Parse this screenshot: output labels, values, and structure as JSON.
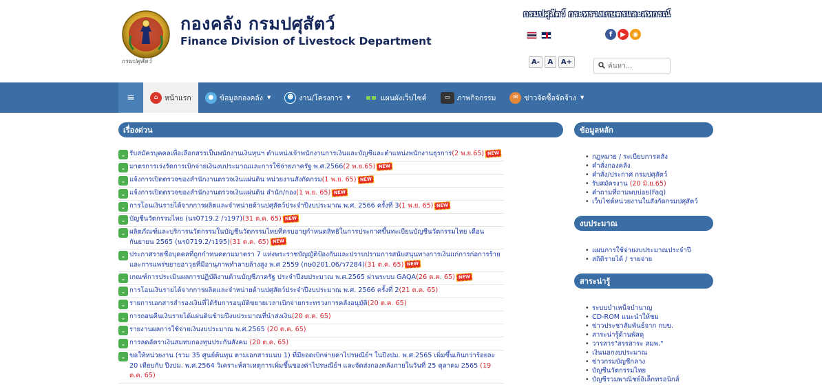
{
  "header": {
    "title_th": "กองคลัง กรมปศุสัตว์",
    "title_en": "Finance Division of Livestock Department",
    "logo_caption": "กรมปศุสัตว์",
    "dept_link": "กรมปศุสัตว์  กระทรวงเกษตรและสหกรณ์",
    "font_buttons": [
      "A-",
      "A",
      "A+"
    ],
    "search_placeholder": "ค้นหา..."
  },
  "nav": {
    "items": [
      {
        "label": "หน้าแรก",
        "icon": "home-icon",
        "active": true
      },
      {
        "label": "ข้อมูลกองคลัง",
        "icon": "people-icon",
        "dropdown": true
      },
      {
        "label": "งาน/โครงการ",
        "icon": "project-icon",
        "dropdown": true
      },
      {
        "label": "แผนผังเว็บไซต์",
        "icon": "sitemap-icon"
      },
      {
        "label": "ภาพกิจกรรม",
        "icon": "gallery-icon"
      },
      {
        "label": "ข่าวจัดซื้อจัดจ้าง",
        "icon": "news-icon",
        "dropdown": true
      }
    ]
  },
  "main": {
    "section_title": "เรื่องด่วน",
    "new_badge": "NEW",
    "news": [
      {
        "text": "รับสมัครบุคคลเพื่อเลือกสรรเป็นพนักงานเงินทุนฯ ตำแหน่งเจ้าพนักงานการเงินและบัญชีและตำแหน่งพนักงานธุรการ",
        "date": "(2 พ.ย.65)",
        "new": true
      },
      {
        "text": "มาตรการเร่งรัดการเบิกจ่ายเงินงบประมาณและการใช้จ่ายภาครัฐ พ.ศ.2566",
        "date": "(2 พ.ย.65)",
        "new": true
      },
      {
        "text": "แจ้งการเปิดตรวจของสำนักงานตรวจเงินแผ่นดิน หน่วยงานสังกัดกรม",
        "date": "(1 พ.ย. 65)",
        "new": true
      },
      {
        "text": "แจ้งการเปิดตรวจของสำนักงานตรวจเงินแผ่นดิน สำนัก/กอง",
        "date": "(1 พ.ย. 65)",
        "new": true
      },
      {
        "text": "การโอนเงินรายได้จากการผลิตและจำหน่ายด้านปศุสัตว์ประจำปีงบประมาณ พ.ศ. 2566 ครั้งที่ 3",
        "date": "(1 พ.ย. 65)",
        "new": true
      },
      {
        "text": "บัญชีนวัตกรรมไทย (นร0719.2 /ว197)",
        "date": "(31 ต.ค. 65)",
        "new": true
      },
      {
        "text": "ผลิตภัณฑ์และบริการนวัตกรรมในบัญชีนวัตกรรมไทยที่ครบอายุกำหนดสิทธิในการประกาศขึ้นทะเบียนบัญชีนวัตกรรมไทย เดือนกันยายน 2565 (นร0719.2/ว195)",
        "date": "(31 ต.ค. 65)",
        "new": true
      },
      {
        "text": "ประกาศรายชื่อบุคคลที่ถูกกำหนดตามมาตรา 7 แห่งพระราชบัญญัติป้องกันและปราบปรามการสนับสนุนทางการเงินแก่การก่อการร้าย และการแพร่ขยายอาวุธที่มีอานุภาพทำลายล้างสูง พ.ศ 2559 (กษ0201.06/ว7284)",
        "date": "(31 ต.ค. 65)",
        "new": true
      },
      {
        "text": "เกณฑ์การประเมินผลการปฏิบัติงานด้านบัญชีภาครัฐ ประจำปีงบประมาณ พ.ศ.2565 ผ่านระบบ GAQA",
        "date": "(26 ต.ค. 65)",
        "new": true
      },
      {
        "text": "การโอนเงินรายได้จากการผลิตและจำหน่ายด้านปศุสัตว์ประจำปีงบประมาณ พ.ศ. 2566 ครั้งที่ 2",
        "date": "(21 ต.ค. 65)",
        "new": false
      },
      {
        "text": "รายการเอกสารสำรองเงินที่ได้รับการอนุมัติขยายเวลาเบิกจ่ายกระทรวงการคลังอนุมัติ",
        "date": "(20 ต.ค. 65)",
        "new": false
      },
      {
        "text": "การถอนคืนเงินรายได้แผ่นดินข้ามปีงบประมาณที่นำส่งเงิน",
        "date": "(20 ต.ค. 65)",
        "new": false
      },
      {
        "text": "รายงานผลการใช้จ่ายเงินงบประมาณ พ.ศ.2565  ",
        "date": "(20 ต.ค. 65)",
        "new": false
      },
      {
        "text": "การลดอัตราเงินสมทบกองทุนประกันสังคม  ",
        "date": "(20 ต.ค. 65)",
        "new": false
      },
      {
        "text": "ขอให้หน่วยงาน (รวม 35 ศูนย์ต้นทุน ตามเอกสารแนบ 1) ที่มียอดเบิกจ่ายค่าไปรษณีย์ฯ ในปีงปม. พ.ศ.2565 เพิ่มขึ้นเกินกว่าร้อยละ 20 เทียบกับ ปีงปม. พ.ศ.2564 วิเคราะห์สาเหตุการเพิ่มขึ้นของค่าไปรษณีย์ฯ และจัดส่งกองคลังภายในวันที่ 25 ตุลาคม 2565 ",
        "date": "(19 ต.ค. 65)",
        "new": false
      }
    ]
  },
  "sidebar": {
    "blocks": [
      {
        "title": "ข้อมูลหลัก",
        "items": [
          {
            "text": "กฎหมาย / ระเบียบการคลัง"
          },
          {
            "text": "คำสั่งกองคลัง"
          },
          {
            "text": "คำสั่ง/ประกาศ กรมปศุสัตว์"
          },
          {
            "text": "รับสมัครงาน ",
            "date": "(20 มิ.ย.65)"
          },
          {
            "text": "คำถามที่ถามพบบ่อย(Faq)"
          },
          {
            "text": "เว็บไซต์หน่วยงานในสังกัดกรมปศุสัตว์"
          }
        ]
      },
      {
        "title": "งบประมาณ",
        "items": [
          {
            "text": "แผนการใช้จ่ายงบประมาณประจำปี"
          },
          {
            "text": "สถิติรายได้ / รายจ่าย"
          }
        ]
      },
      {
        "title": "สาระน่ารู้",
        "items": [
          {
            "text": "ระบบบำเหน็จบำนาญ"
          },
          {
            "text": "CD-ROM แนะนำให้ชม"
          },
          {
            "text": "ข่าวประชาสัมพันธ์จาก กบข."
          },
          {
            "text": "สาระน่ารู้ด้านพัสดุ"
          },
          {
            "text": "วารสาร\"สรรสาระ สมพ.\""
          },
          {
            "text": "เงินนอกงบประมาณ"
          },
          {
            "text": "ข่าวกรมบัญชีกลาง"
          },
          {
            "text": "บัญชีนวัตกรรมไทย"
          },
          {
            "text": "บัญชีรวมพาณิชย์อิเล็กทรอนิกส์"
          }
        ]
      }
    ]
  },
  "colors": {
    "nav_bg": "#3a6ea5",
    "link": "#1a3aa8",
    "date": "#d4222a",
    "bullet": "#4cae4c",
    "title": "#16285a"
  }
}
